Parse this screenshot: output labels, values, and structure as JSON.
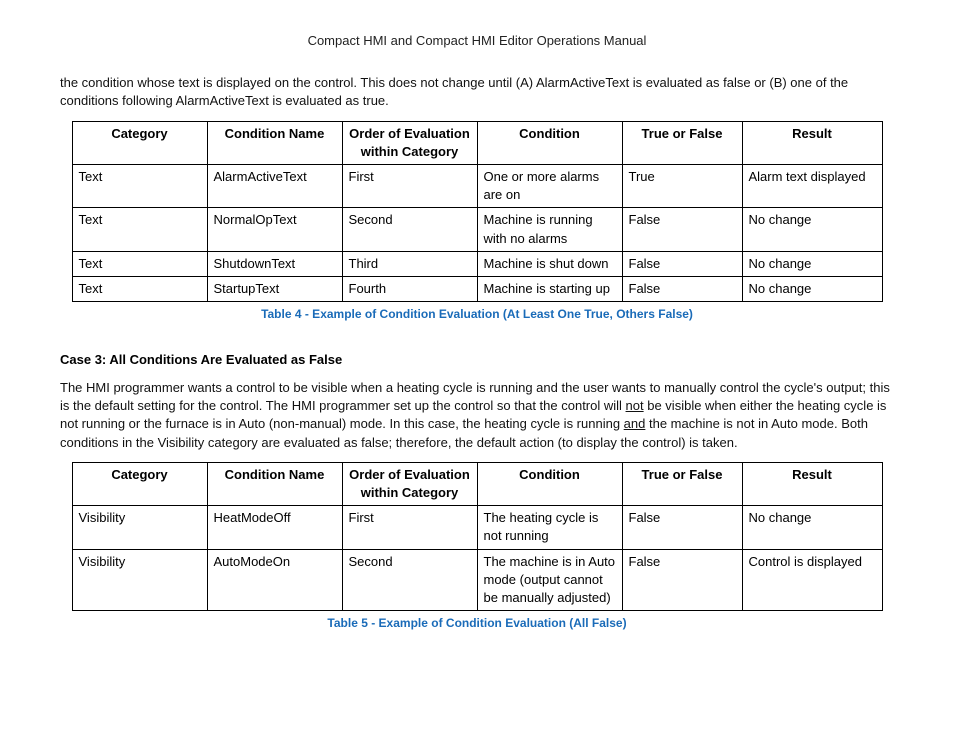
{
  "header": "Compact HMI and Compact HMI Editor Operations Manual",
  "intro_para": "the condition whose text is displayed on the control. This does not change until (A) AlarmActiveText is evaluated as false or (B) one of the conditions following AlarmActiveText is evaluated as true.",
  "table1": {
    "headers": [
      "Category",
      "Condition Name",
      "Order of Evaluation within Category",
      "Condition",
      "True or False",
      "Result"
    ],
    "rows": [
      [
        "Text",
        "AlarmActiveText",
        "First",
        "One or more alarms are on",
        "True",
        "Alarm text displayed"
      ],
      [
        "Text",
        "NormalOpText",
        "Second",
        "Machine is running with no alarms",
        "False",
        "No change"
      ],
      [
        "Text",
        "ShutdownText",
        "Third",
        "Machine is shut down",
        "False",
        "No change"
      ],
      [
        "Text",
        "StartupText",
        "Fourth",
        "Machine is starting up",
        "False",
        "No change"
      ]
    ],
    "caption": "Table 4 - Example of Condition Evaluation (At Least One True, Others False)"
  },
  "case3": {
    "heading": "Case 3: All Conditions Are Evaluated as False",
    "p1a": "The HMI programmer wants a control to be visible when a heating cycle is running and the user wants to manually control the cycle's output; this is the default setting for the control. The HMI programmer set up the control so that the control will ",
    "p1_not": "not",
    "p1b": " be visible when either the heating cycle is not running or the furnace is in Auto (non-manual) mode. In this case, the heating cycle is running ",
    "p1_and": "and",
    "p1c": " the machine is not in Auto mode. Both conditions in the Visibility category are evaluated as false; therefore, the default action (to display the control) is taken."
  },
  "table2": {
    "headers": [
      "Category",
      "Condition Name",
      "Order of Evaluation within Category",
      "Condition",
      "True or False",
      "Result"
    ],
    "rows": [
      [
        "Visibility",
        "HeatModeOff",
        "First",
        "The heating cycle is not running",
        "False",
        "No change"
      ],
      [
        "Visibility",
        "AutoModeOn",
        "Second",
        "The machine is in Auto mode (output cannot be manually adjusted)",
        "False",
        "Control is displayed"
      ]
    ],
    "caption": "Table 5 - Example of Condition Evaluation (All False)"
  }
}
